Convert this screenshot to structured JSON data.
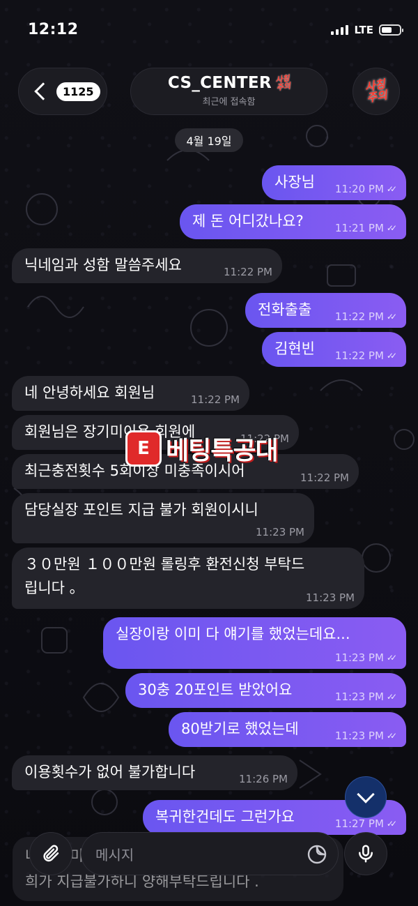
{
  "status_bar": {
    "time": "12:12",
    "network": "LTE",
    "battery_level": 0.6
  },
  "header": {
    "back_count": "1125",
    "title": "CS_CENTER",
    "title_badge": "사칭\n주의",
    "subtitle": "최근에 접속함",
    "avatar_text": "사칭\n주의"
  },
  "date_chip": "4월 19일",
  "messages": [
    {
      "dir": "out",
      "text": "사장님",
      "time": "11:20 PM",
      "read": true
    },
    {
      "dir": "out",
      "text": "제 돈 어디갔나요?",
      "time": "11:21 PM",
      "read": true
    },
    {
      "dir": "in",
      "text": "닉네임과 성함 말씀주세요",
      "time": "11:22 PM"
    },
    {
      "dir": "out",
      "text": "전화출출",
      "time": "11:22 PM",
      "read": true
    },
    {
      "dir": "out",
      "text": "김현빈",
      "time": "11:22 PM",
      "read": true
    },
    {
      "dir": "in",
      "text": "네 안녕하세요 회원님",
      "time": "11:22 PM"
    },
    {
      "dir": "in",
      "text": "회원님은 장기미이용 회원에",
      "time": "11:22 PM"
    },
    {
      "dir": "in",
      "text": "최근충전횟수 5회이상 미충족이시어",
      "time": "11:22 PM"
    },
    {
      "dir": "in",
      "text": "담당실장 포인트 지급 불가 회원이시니",
      "time": "11:23 PM"
    },
    {
      "dir": "in",
      "text": "３０만원 １００만원 롤링후 환전신청 부탁드립니다 。",
      "line1": "３０만원 １００만원 롤링후 환전신청 부탁드",
      "line2": "립니다 。",
      "time": "11:23 PM"
    },
    {
      "dir": "out",
      "text": "실장이랑 이미 다 얘기를 했었는데요...",
      "time": "11:23 PM",
      "read": true
    },
    {
      "dir": "out",
      "text": "30충 20포인트 받았어요",
      "time": "11:23 PM",
      "read": true
    },
    {
      "dir": "out",
      "text": "80받기로 했었는데",
      "time": "11:23 PM",
      "read": true
    },
    {
      "dir": "in",
      "text": "이용횟수가 없어 불가합니다",
      "time": "11:26 PM"
    },
    {
      "dir": "out",
      "text": "복귀한건데도 그런가요",
      "time": "11:27 PM",
      "read": true
    }
  ],
  "faded_message": {
    "line1": "네 장기미이용 회원은 지급 불가",
    "line2": "희가 지급불가하니 양해부탁드립니다 ."
  },
  "watermark": {
    "logo": "E",
    "text": "베팅특공대"
  },
  "input": {
    "placeholder": "메시지"
  },
  "colors": {
    "outgoing_start": "#6a56f0",
    "outgoing_end": "#8a5cf2",
    "incoming": "#24242b",
    "warning_red": "#ff3b30"
  },
  "icons": {
    "back": "chevron-left-icon",
    "attach": "paperclip-icon",
    "sticker": "sticker-icon",
    "mic": "microphone-icon",
    "scroll": "chevron-down-icon"
  }
}
